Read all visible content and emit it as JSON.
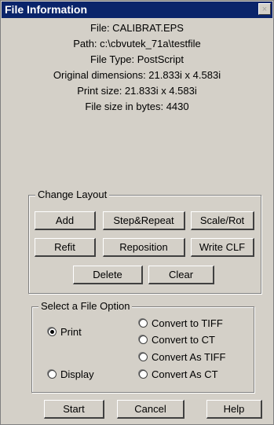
{
  "window": {
    "title": "File Information",
    "close_glyph": "×"
  },
  "info": {
    "file": "File: CALIBRAT.EPS",
    "path": "Path: c:\\cbvutek_71a\\testfile",
    "type": "File Type: PostScript",
    "original_dimensions": "Original dimensions: 21.833i x 4.583i",
    "print_size": "Print size: 21.833i x 4.583i",
    "file_size": "File size in bytes: 4430"
  },
  "change_layout": {
    "label": "Change Layout",
    "buttons": {
      "add": "Add",
      "step_repeat": "Step&Repeat",
      "scale_rot": "Scale/Rot",
      "refit": "Refit",
      "reposition": "Reposition",
      "write_clf": "Write CLF",
      "delete": "Delete",
      "clear": "Clear"
    }
  },
  "file_option": {
    "label": "Select a File Option",
    "selected": "Print",
    "options": {
      "print": "Print",
      "display": "Display",
      "convert_to_tiff": "Convert to TIFF",
      "convert_to_ct": "Convert to CT",
      "convert_as_tiff": "Convert As TIFF",
      "convert_as_ct": "Convert As CT"
    }
  },
  "footer": {
    "start": "Start",
    "cancel": "Cancel",
    "help": "Help"
  }
}
